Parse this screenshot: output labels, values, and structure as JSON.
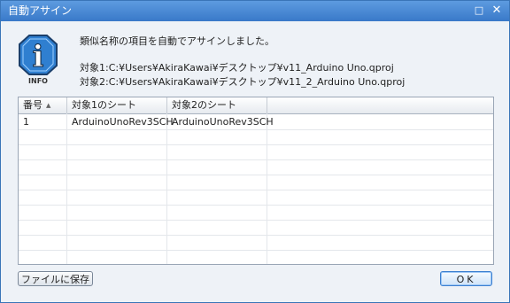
{
  "window": {
    "title": "自動アサイン",
    "maximize_glyph": "□",
    "close_glyph": "✕"
  },
  "info": {
    "icon": "info-icon",
    "label": "INFO",
    "glyph": "i"
  },
  "message": {
    "line1": "類似名称の項目を自動でアサインしました。",
    "line2": "対象1:C:¥Users¥AkiraKawai¥デスクトップ¥v11_Arduino Uno.qproj",
    "line3": "対象2:C:¥Users¥AkiraKawai¥デスクトップ¥v11_2_Arduino Uno.qproj"
  },
  "table": {
    "columns": [
      "番号",
      "対象1のシート",
      "対象2のシート"
    ],
    "sorted_column": 0,
    "sort_direction": "ascending",
    "rows": [
      [
        "1",
        "ArduinoUnoRev3SCH",
        "ArduinoUnoRev3SCH"
      ]
    ]
  },
  "buttons": {
    "save_label": "ファイルに保存",
    "ok_label": "OK"
  },
  "colors": {
    "titlebar": "#3979c9",
    "icon_fill": "#2f7fd0",
    "ok_border": "#3c7fd0"
  }
}
